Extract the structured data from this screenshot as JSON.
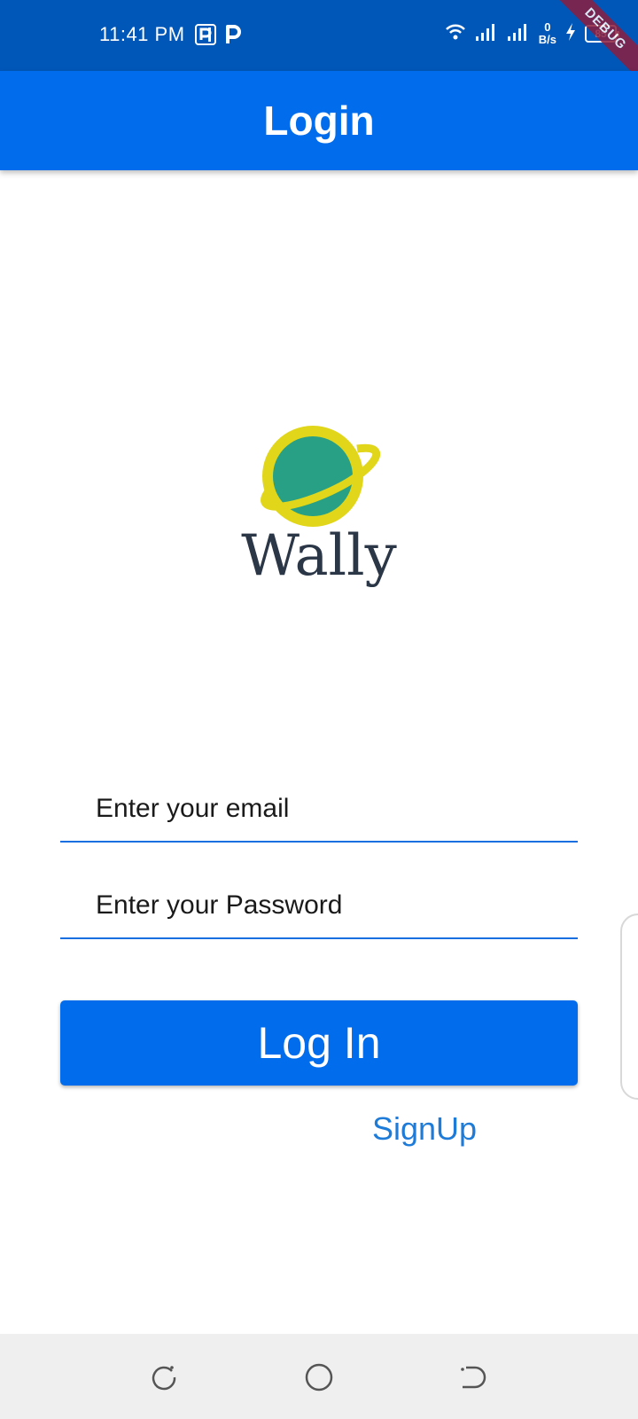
{
  "status_bar": {
    "time": "11:41 PM",
    "net_speed_value": "0",
    "net_speed_unit": "B/s",
    "battery": "85",
    "debug_label": "DEBUG",
    "icons": [
      "parking-app-icon",
      "p-app-icon",
      "wifi-icon",
      "signal-icon",
      "signal-icon",
      "charging-icon",
      "battery-icon"
    ]
  },
  "app_bar": {
    "title": "Login",
    "color": "#016ded"
  },
  "logo": {
    "text": "Wally",
    "planet_color": "#27a085",
    "ring_color": "#e1d61a"
  },
  "form": {
    "email_placeholder": "Enter your email",
    "password_placeholder": "Enter your Password",
    "login_label": "Log In",
    "signup_label": "SignUp"
  },
  "nav_bar": {
    "icons": [
      "recent-apps-icon",
      "home-icon",
      "back-icon"
    ]
  }
}
